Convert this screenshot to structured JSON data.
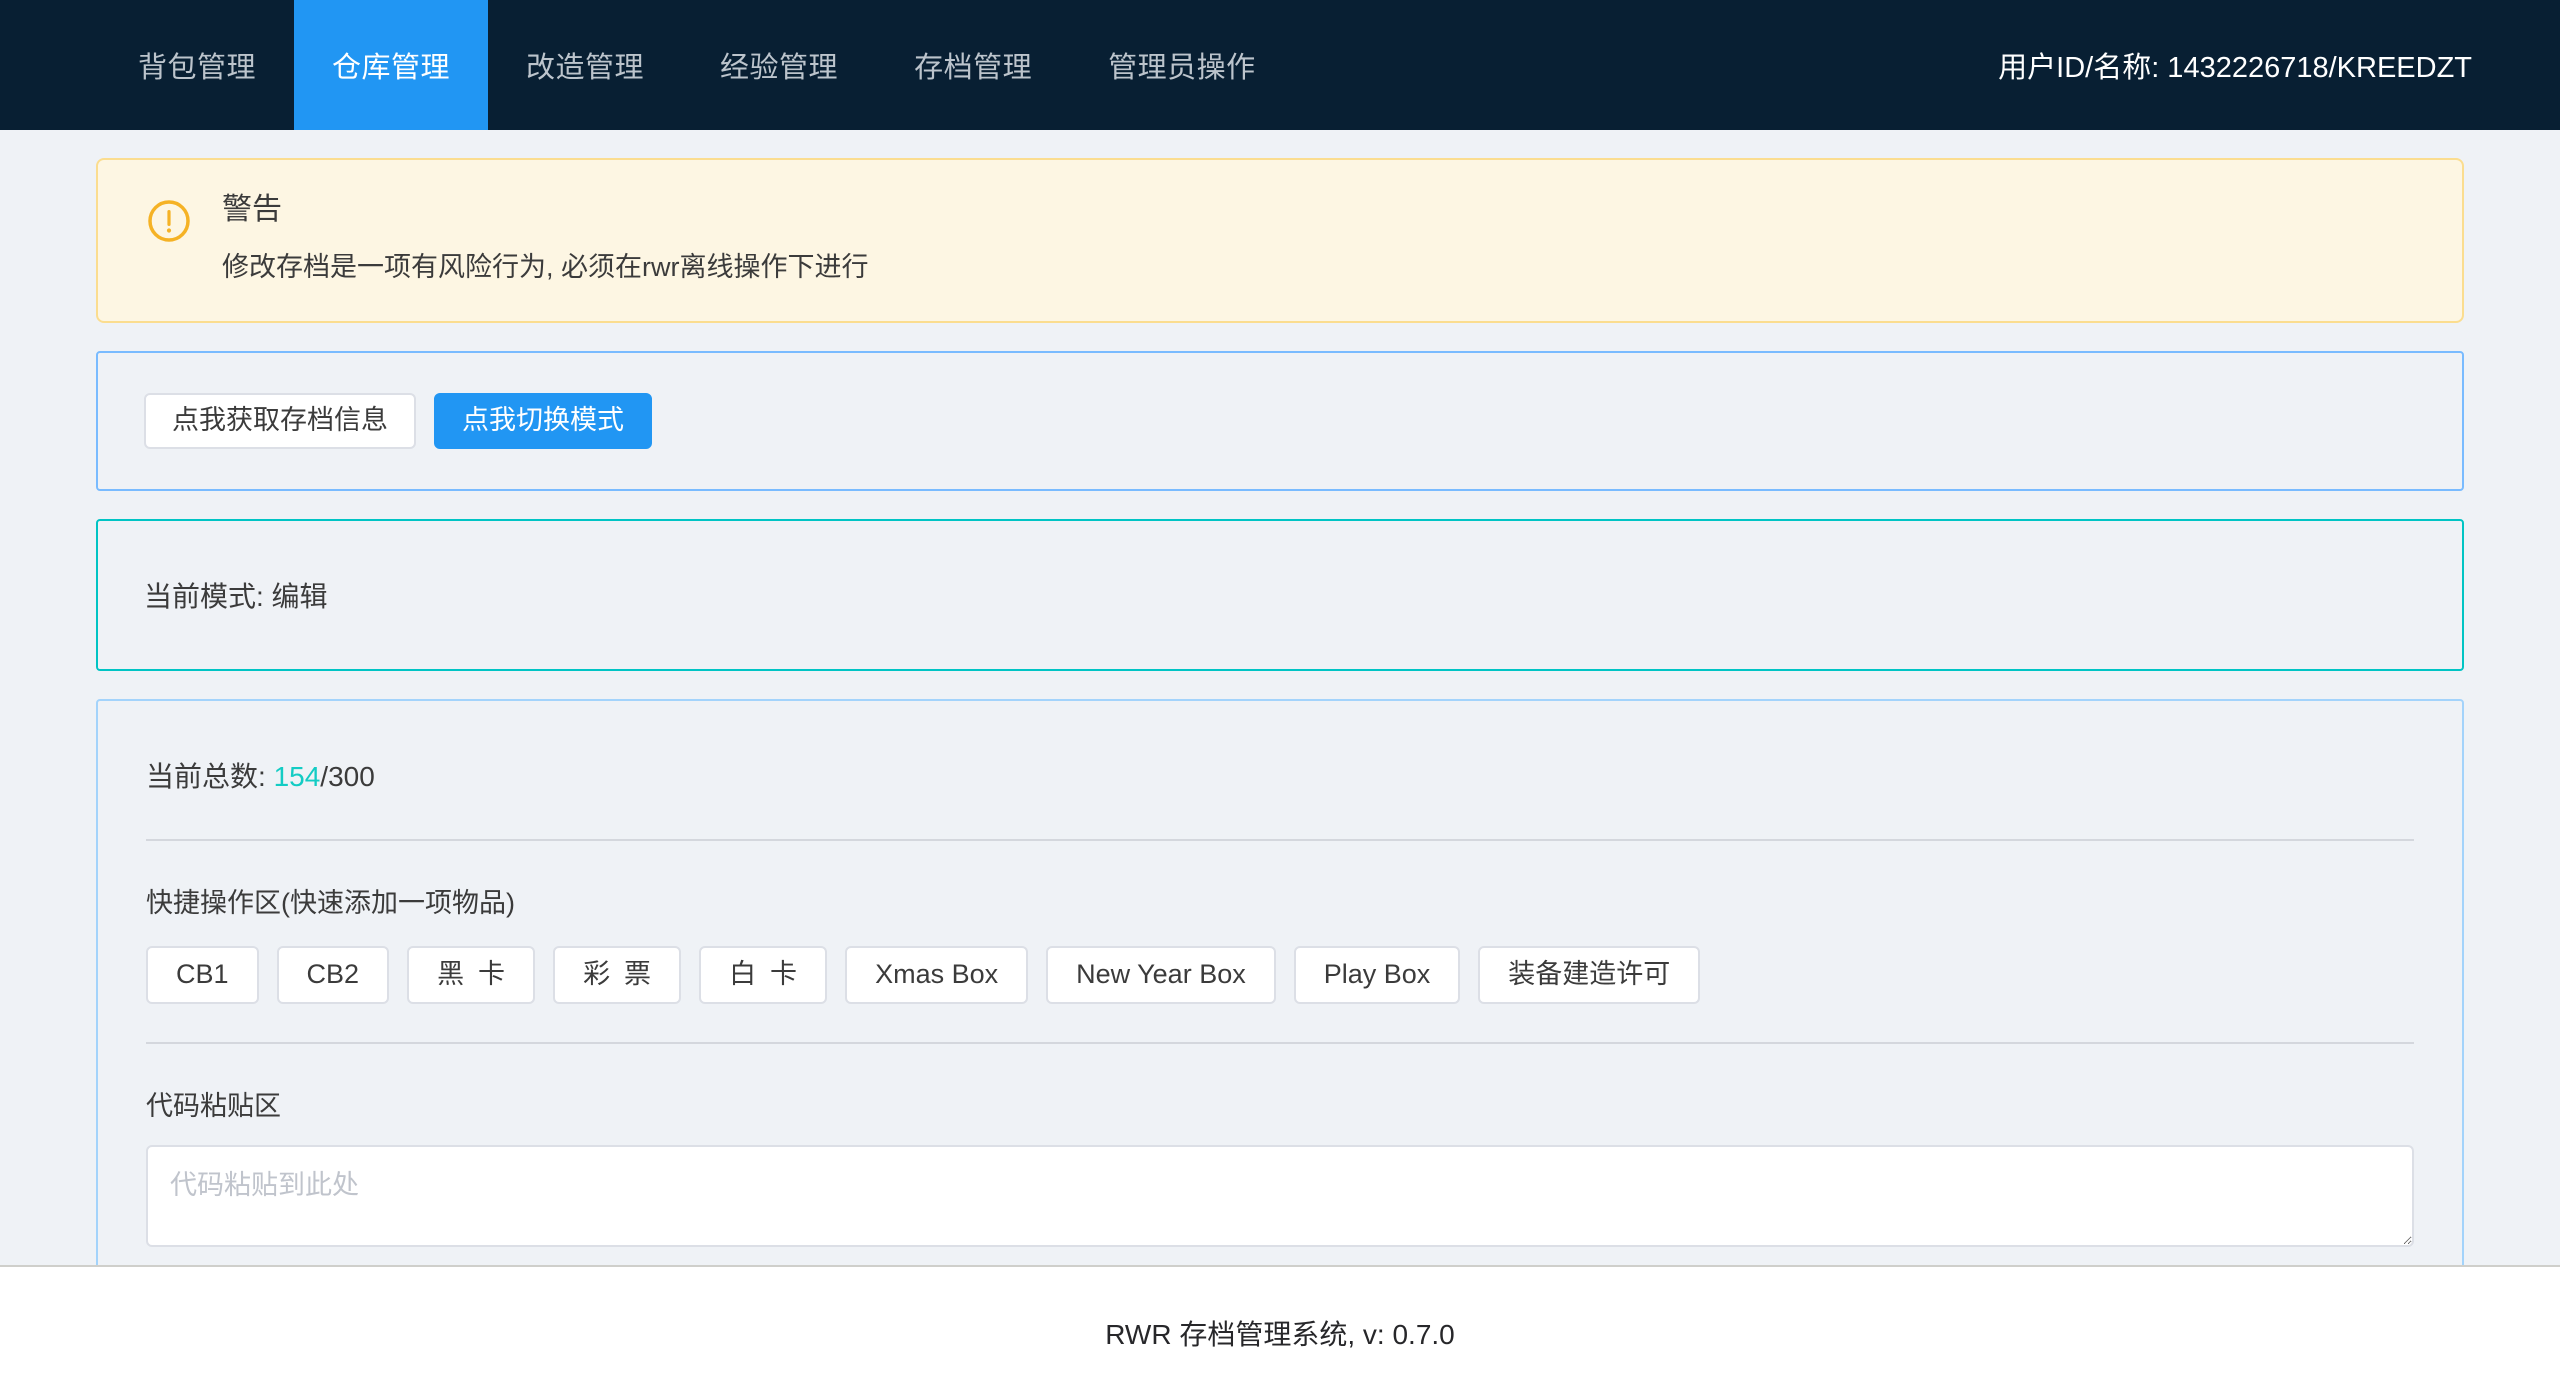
{
  "nav": {
    "items": [
      {
        "label": "背包管理",
        "active": false
      },
      {
        "label": "仓库管理",
        "active": true
      },
      {
        "label": "改造管理",
        "active": false
      },
      {
        "label": "经验管理",
        "active": false
      },
      {
        "label": "存档管理",
        "active": false
      },
      {
        "label": "管理员操作",
        "active": false
      }
    ],
    "user_info": "用户ID/名称: 1432226718/KREEDZT"
  },
  "alert": {
    "icon": "warning-circle-icon",
    "title": "警告",
    "description": "修改存档是一项有风险行为, 必须在rwr离线操作下进行",
    "border_color": "#fbdd8f",
    "background_color": "#fdf6e3",
    "icon_color": "#f5b225"
  },
  "actions": {
    "fetch_label": "点我获取存档信息",
    "switch_mode_label": "点我切换模式"
  },
  "mode_panel": {
    "text": "当前模式: 编辑",
    "border_color": "#00c4c4"
  },
  "stock": {
    "count_prefix": "当前总数: ",
    "current": "154",
    "separator": "/",
    "max": "300",
    "count_color": "#13ccc4",
    "quick_section_label": "快捷操作区(快速添加一项物品)",
    "quick_buttons": [
      {
        "label": "CB1",
        "spread": false
      },
      {
        "label": "CB2",
        "spread": false
      },
      {
        "label": "黑卡",
        "spread": true
      },
      {
        "label": "彩票",
        "spread": true
      },
      {
        "label": "白卡",
        "spread": true
      },
      {
        "label": "Xmas Box",
        "spread": false
      },
      {
        "label": "New Year Box",
        "spread": false
      },
      {
        "label": "Play Box",
        "spread": false
      },
      {
        "label": "装备建造许可",
        "spread": false
      }
    ],
    "paste_label": "代码粘贴区",
    "paste_placeholder": "代码粘贴到此处",
    "paste_value": ""
  },
  "footer": {
    "text": "RWR 存档管理系统, v: 0.7.0"
  },
  "theme": {
    "nav_background": "#081f33",
    "accent_blue": "#2196f3",
    "page_background": "#eff2f6"
  }
}
